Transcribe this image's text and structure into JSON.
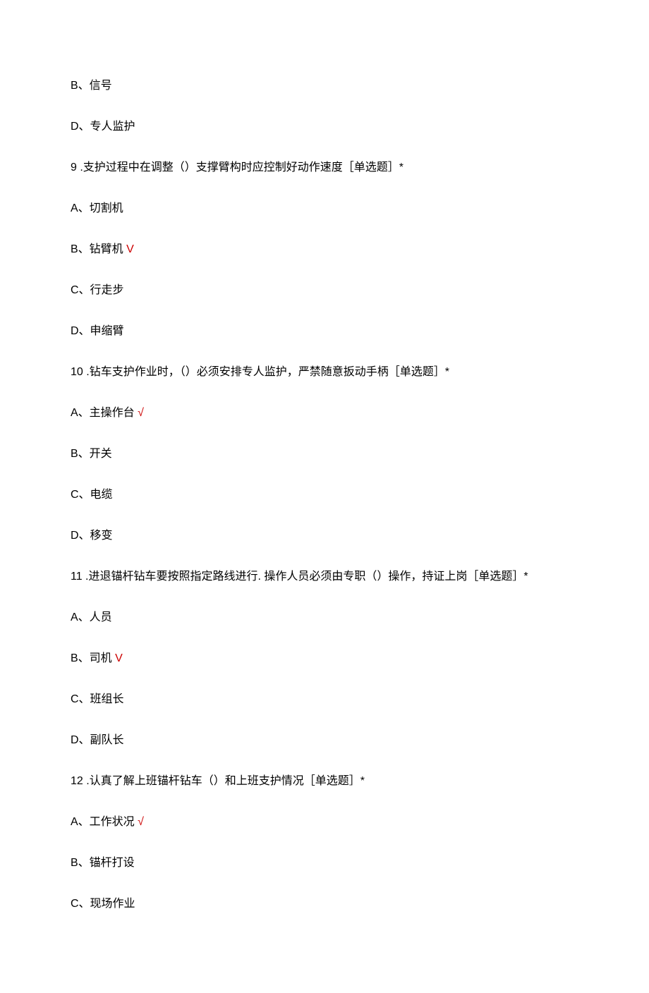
{
  "partial_q8": {
    "option_b": "B、信号",
    "option_d": "D、专人监护"
  },
  "q9": {
    "stem": "9   .支护过程中在调整（）支撑臂构时应控制好动作速度［单选题］*",
    "option_a": "A、切割机",
    "option_b_text": "B、钻臂机",
    "option_b_mark": " V",
    "option_c": "C、行走步",
    "option_d": "D、申缩臂"
  },
  "q10": {
    "stem": "10   .钻车支护作业时，（）必须安排专人监护，严禁随意扳动手柄［单选题］*",
    "option_a_text": "A、主操作台",
    "option_a_mark": " √",
    "option_b": "B、开关",
    "option_c": "C、电缆",
    "option_d": "D、移变"
  },
  "q11": {
    "stem": "11   .进退锚杆钻车要按照指定路线进行. 操作人员必须由专职（）操作，持证上岗［单选题］*",
    "option_a": "A、人员",
    "option_b_text": "B、司机",
    "option_b_mark": " V",
    "option_c": "C、班组长",
    "option_d": "D、副队长"
  },
  "q12": {
    "stem": "12   .认真了解上班锚杆钻车（）和上班支护情况［单选题］*",
    "option_a_text": "A、工作状况",
    "option_a_mark": " √",
    "option_b": "B、锚杆打设",
    "option_c": "C、现场作业"
  }
}
